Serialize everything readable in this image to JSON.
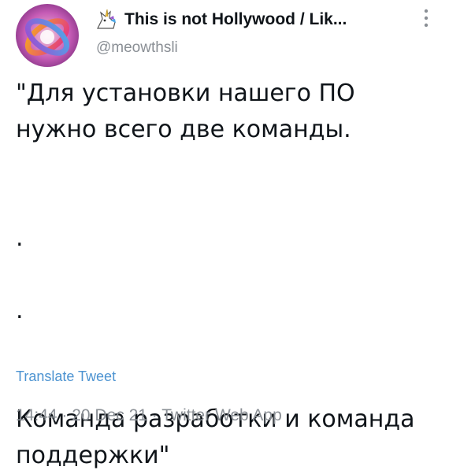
{
  "author": {
    "display_name": "This is not Hollywood / Lik...",
    "handle": "@meowthsli",
    "avatar_icon": "gradient-orb-avatar",
    "badge_icon": "unicorn-icon"
  },
  "menu": {
    "more_icon": "more-vertical-icon"
  },
  "tweet": {
    "text": "\"Для установки нашего ПО\nнужно всего две команды.\n\n\n.\n\n.\n\n\nКоманда разработки и команда\nподдержки\""
  },
  "actions": {
    "translate_label": "Translate Tweet"
  },
  "meta": {
    "time": "14:44",
    "separator1": " · ",
    "date": "20 Dec 21",
    "separator2": " · ",
    "client": "Twitter Web App"
  },
  "colors": {
    "text": "#0f1419",
    "secondary": "#8a8f95",
    "link": "#4c93d1"
  }
}
